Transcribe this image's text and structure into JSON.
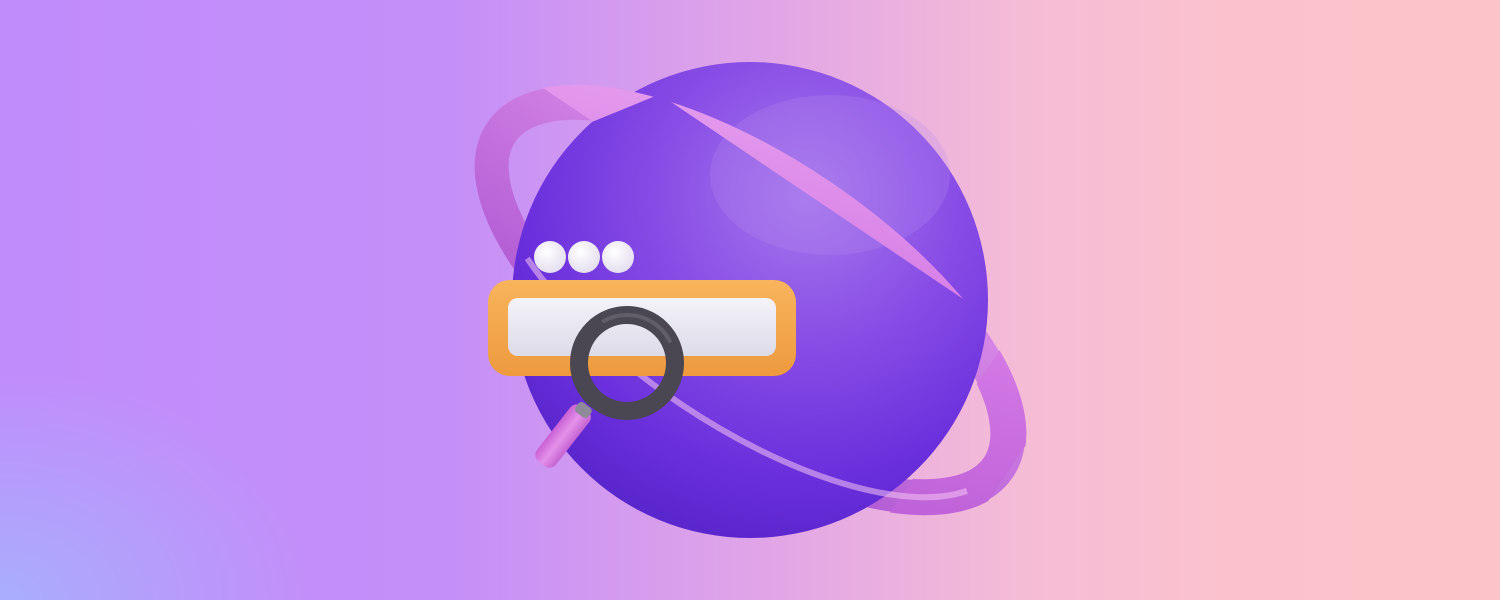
{
  "scene": {
    "subject": "planet-with-ring-search-illustration",
    "colors": {
      "background_left": "#c08cfb",
      "background_right": "#fcc4c8",
      "planet": "#6b2fe0",
      "ring": "#d77ee6",
      "search_bar_frame": "#f5a84d",
      "search_bar_field": "#ecebf4",
      "magnifier_rim": "#4d4a55",
      "magnifier_handle": "#d774de",
      "dots": "#f2eef8"
    },
    "icons": [
      "planet-icon",
      "ring-icon",
      "search-bar-icon",
      "magnifier-icon",
      "window-dots-icon"
    ]
  }
}
